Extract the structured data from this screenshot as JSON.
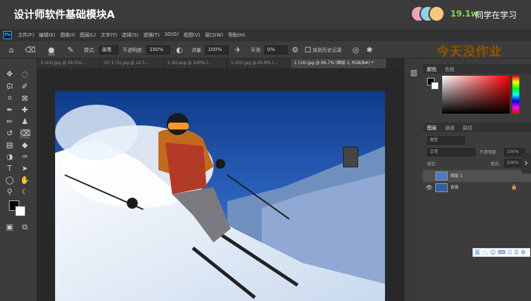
{
  "course": {
    "title": "设计师软件基础模块A",
    "viewer_count": "19.1w",
    "viewer_label": "同学在学习"
  },
  "app": {
    "logo": "Ps",
    "menu": [
      "文件(F)",
      "编辑(E)",
      "图像(I)",
      "图层(L)",
      "文字(Y)",
      "选择(S)",
      "滤镜(T)",
      "3D(D)",
      "视图(V)",
      "窗口(W)",
      "帮助(H)"
    ]
  },
  "options": {
    "brush_size": "400",
    "mode_label": "模式:",
    "mode_value": "画笔",
    "opacity_label": "不透明度:",
    "opacity_value": "100%",
    "flow_label": "流量:",
    "flow_value": "100%",
    "smoothing_label": "平滑:",
    "smoothing_value": "0%",
    "erase_history_label": "抹到历史记录"
  },
  "watermark": "今天没作业",
  "tabs": [
    {
      "label": "1 (22).jpg @ 29.5%(...",
      "active": false
    },
    {
      "label": "(C) 1 (3).jpg @ 12.5...",
      "active": false
    },
    {
      "label": "1 (6).png @ 100% (...",
      "active": false
    },
    {
      "label": "1 (25).jpg @ 45.8% (...",
      "active": false
    },
    {
      "label": "1 (14).jpg @ 66.7% (图层 1, RGB/8#) *",
      "active": true
    }
  ],
  "panels": {
    "color_tabs": [
      "颜色",
      "色板"
    ],
    "layer_tabs": [
      "图层",
      "通道",
      "路径"
    ],
    "kind_label": "类型",
    "blend_mode": "正常",
    "opacity_label": "不透明度:",
    "opacity_value": "100%",
    "lock_label": "锁定:",
    "fill_label": "填充:",
    "fill_value": "100%",
    "layers": [
      {
        "name": "图层 1",
        "selected": true
      },
      {
        "name": "背景",
        "selected": false
      }
    ]
  },
  "ime": {
    "text": "英 ◌, ☺ ⌨ ☷ ☰ ⚙"
  },
  "colors": {
    "accent_green": "#7ddc4f",
    "watermark_orange": "#f5a623",
    "ps_blue": "#31a8ff"
  }
}
